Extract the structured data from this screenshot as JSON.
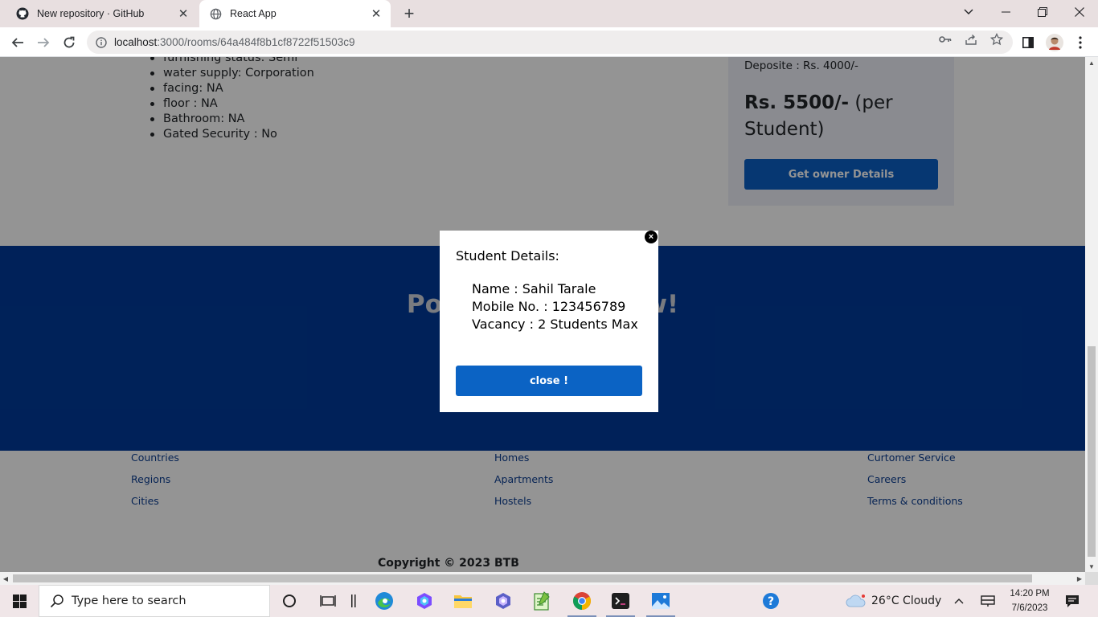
{
  "browser": {
    "tabs": [
      {
        "title": "New repository · GitHub",
        "active": false,
        "icon": "github-icon"
      },
      {
        "title": "React App",
        "active": true,
        "icon": "globe-icon"
      }
    ],
    "url_host": "localhost",
    "url_path": ":3000/rooms/64a484f8b1cf8722f51503c9"
  },
  "page": {
    "features": [
      "furnishing status: Semi",
      "water supply: Corporation",
      "facing: NA",
      "floor : NA",
      "Bathroom: NA",
      "Gated Security : No"
    ],
    "deposit": "Deposite : Rs. 4000/-",
    "price_bold": "Rs. 5500/-",
    "price_suffix": " (per Student)",
    "owner_button": "Get owner Details",
    "banner_left": "Pos",
    "banner_right": "w!",
    "footer": {
      "col1": [
        "Countries",
        "Regions",
        "Cities"
      ],
      "col2": [
        "Homes",
        "Apartments",
        "Hostels"
      ],
      "col3": [
        "Curtomer Service",
        "Careers",
        "Terms & conditions"
      ]
    },
    "copyright": "Copyright © 2023 BTB"
  },
  "modal": {
    "close_x": "×",
    "heading": "Student Details:",
    "name": "Name : Sahil Tarale",
    "mobile": "Mobile No. : 123456789",
    "vacancy": "Vacancy : 2 Students Max",
    "close_button": "close !"
  },
  "taskbar": {
    "search_placeholder": "Type here to search",
    "weather": "26°C  Cloudy",
    "time": "14:20 PM",
    "date": "7/6/2023"
  },
  "colors": {
    "primary_button": "#0b63c4",
    "banner": "#003a9a",
    "link": "#0b3d91"
  }
}
